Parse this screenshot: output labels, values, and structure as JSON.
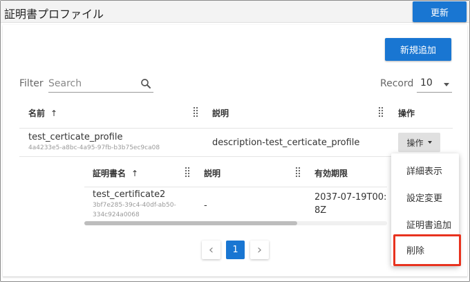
{
  "header": {
    "title": "証明書プロファイル",
    "refresh_label": "更新"
  },
  "toolbar": {
    "new_label": "新規追加",
    "filter_label": "Filter",
    "search_placeholder": "Search",
    "record_label": "Record",
    "record_value": "10"
  },
  "table": {
    "columns": {
      "name": "名前",
      "sort_icon": "↑",
      "description": "説明",
      "actions": "操作"
    },
    "row": {
      "name": "test_certicate_profile",
      "id": "4a4233e5-a8bc-4a95-97fb-b3b75ec9ca08",
      "description": "description-test_certicate_profile",
      "action_label": "操作"
    }
  },
  "subtable": {
    "columns": {
      "name": "証明書名",
      "sort_icon": "↑",
      "description": "説明",
      "expiry": "有効期限"
    },
    "row": {
      "name": "test_certificate2",
      "id_line1": "3bf7e285-39c4-40df-ab50-",
      "id_line2": "334c924a0068",
      "description": "-",
      "expiry_line1": "2037-07-19T00:",
      "expiry_line2": "8Z"
    }
  },
  "menu": {
    "items": [
      "詳細表示",
      "設定変更",
      "証明書追加",
      "削除"
    ],
    "highlight_color": "#e8321e"
  },
  "pagination": {
    "prev_icon": "‹",
    "current_page": "1",
    "next_icon": "›"
  },
  "colors": {
    "primary": "#1976d2"
  },
  "icons": [
    "search-icon",
    "sort-up-icon",
    "drag-handle-icon",
    "caret-down-icon",
    "chevron-left-icon",
    "chevron-right-icon"
  ]
}
